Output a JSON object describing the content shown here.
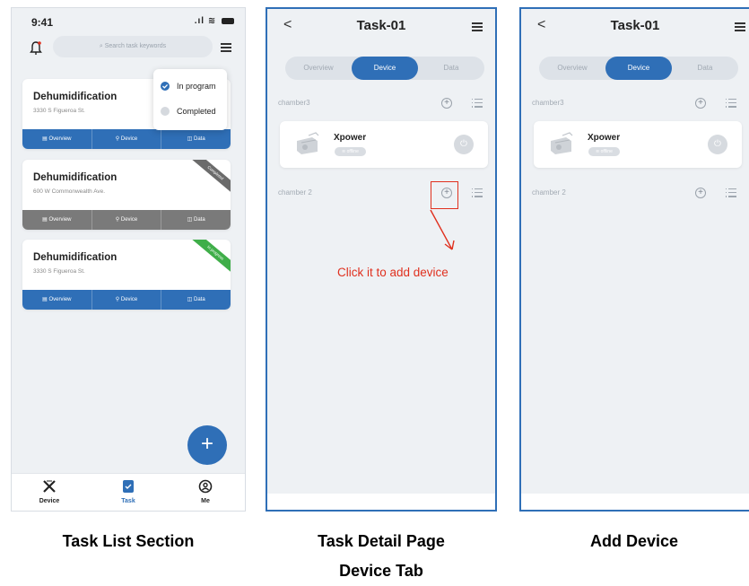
{
  "phone1": {
    "status": {
      "time": "9:41"
    },
    "search_placeholder": "Search task keywords",
    "dropdown": [
      {
        "label": "In program",
        "color": "#2f6fb7"
      },
      {
        "label": "Completed",
        "color": "#d5d9de"
      }
    ],
    "tasks": [
      {
        "title": "Dehumidification",
        "address": "3330 S Figueroa St.",
        "bar_color": "#2f6fb7",
        "ribbon": ""
      },
      {
        "title": "Dehumidification",
        "address": "600 W Commonwealth Ave.",
        "bar_color": "#7a7a7a",
        "ribbon": "Completed",
        "ribbon_color": "#6b6b6b"
      },
      {
        "title": "Dehumidification",
        "address": "3330 S Figueroa St.",
        "bar_color": "#2f6fb7",
        "ribbon": "In progress",
        "ribbon_color": "#3fae49"
      }
    ],
    "task_actions": [
      "Overview",
      "Device",
      "Data"
    ],
    "fab_icon": "+",
    "nav": [
      {
        "label": "Device",
        "icon": "device-icon"
      },
      {
        "label": "Task",
        "icon": "task-icon"
      },
      {
        "label": "Me",
        "icon": "me-icon"
      }
    ]
  },
  "phone2": {
    "title": "Task-01",
    "tabs": [
      "Overview",
      "Device",
      "Data"
    ],
    "active_tab": "Device",
    "chambers": [
      "chamber3",
      "chamber 2"
    ],
    "device": {
      "name": "Xpower",
      "status": "offline"
    },
    "annotation": "Click it to add device"
  },
  "phone3": {
    "title": "Task-01",
    "tabs": [
      "Overview",
      "Device",
      "Data"
    ],
    "active_tab": "Device",
    "chambers": [
      "chamber3",
      "chamber 2"
    ],
    "device": {
      "name": "Xpower",
      "status": "offline"
    }
  },
  "captions": {
    "left": "Task List Section",
    "middle_line1": "Task Detail Page",
    "middle_line2": "Device Tab",
    "right": "Add Device"
  },
  "colors": {
    "primary": "#2f6fb7",
    "annotation": "#e0301e",
    "background": "#eef1f4"
  }
}
